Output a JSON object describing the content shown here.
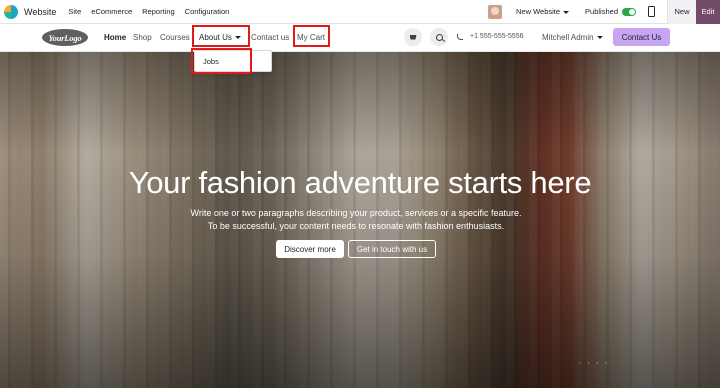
{
  "admin_bar": {
    "app_name": "Website",
    "menu": [
      "Site",
      "eCommerce",
      "Reporting",
      "Configuration"
    ],
    "site_switcher": "New Website",
    "published_label": "Published",
    "published": true,
    "new_label": "New",
    "edit_label": "Edit",
    "edit_color": "#714b67"
  },
  "navbar": {
    "logo_text": "YourLogo",
    "items": [
      "Home",
      "Shop",
      "Courses",
      "About Us",
      "Contact us",
      "My Cart"
    ],
    "active_item": "Home",
    "phone": "+1 555-555-5556",
    "user": "Mitchell Admin",
    "cta_label": "Contact Us",
    "cta_color": "#c8a5f3"
  },
  "dropdown": {
    "items": [
      "Jobs"
    ]
  },
  "hero": {
    "title": "Your fashion adventure starts here",
    "line1": "Write one or two paragraphs describing your product, services or a specific feature.",
    "line2": "To be successful, your content needs to resonate with fashion enthusiasts.",
    "primary_button": "Discover more",
    "secondary_button": "Get in touch with us"
  },
  "annotation_color": "#e01b1b"
}
